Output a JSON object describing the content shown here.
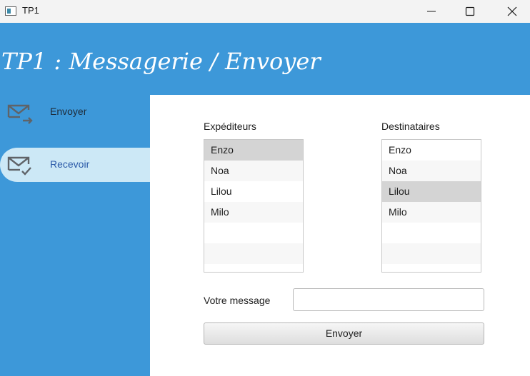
{
  "window": {
    "title": "TP1"
  },
  "header": {
    "title": "TP1 : Messagerie / Envoyer"
  },
  "sidebar": {
    "items": [
      {
        "label": "Envoyer",
        "icon": "mail-send-icon"
      },
      {
        "label": "Recevoir",
        "icon": "mail-check-icon",
        "active": true
      }
    ]
  },
  "form": {
    "senders_label": "Expéditeurs",
    "recipients_label": "Destinataires",
    "senders": [
      "Enzo",
      "Noa",
      "Lilou",
      "Milo"
    ],
    "senders_selected": "Enzo",
    "recipients": [
      "Enzo",
      "Noa",
      "Lilou",
      "Milo"
    ],
    "recipients_selected": "Lilou",
    "message_label": "Votre message",
    "message_value": "",
    "send_label": "Envoyer"
  },
  "colors": {
    "header_bg": "#3d98d9",
    "active_nav_bg": "#cce8f6",
    "selection_bg": "#d4d4d4"
  }
}
